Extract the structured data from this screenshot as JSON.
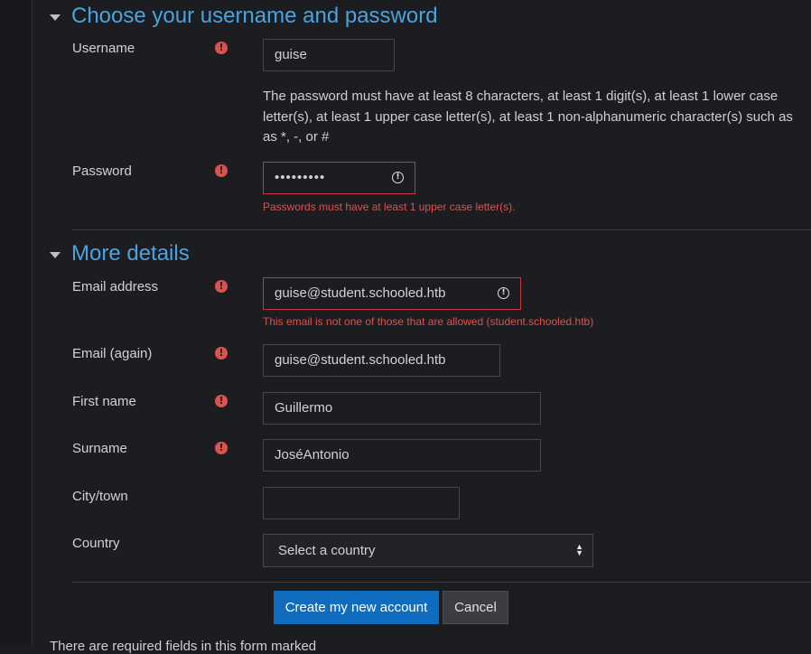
{
  "section_account": {
    "title": "Choose your username and password"
  },
  "username": {
    "label": "Username",
    "value": "guise"
  },
  "password_policy": "The password must have at least 8 characters, at least 1 digit(s), at least 1 lower case letter(s), at least 1 upper case letter(s), at least 1 non-alphanumeric character(s) such as as *, -, or #",
  "password": {
    "label": "Password",
    "value": "•••••••••",
    "error": "Passwords must have at least 1 upper case letter(s)."
  },
  "section_details": {
    "title": "More details"
  },
  "email": {
    "label": "Email address",
    "value": "guise@student.schooled.htb",
    "error": "This email is not one of those that are allowed (student.schooled.htb)"
  },
  "email_again": {
    "label": "Email (again)",
    "value": "guise@student.schooled.htb"
  },
  "firstname": {
    "label": "First name",
    "value": "Guillermo"
  },
  "surname": {
    "label": "Surname",
    "value": "JoséAntonio"
  },
  "city": {
    "label": "City/town",
    "value": ""
  },
  "country": {
    "label": "Country",
    "selected": "Select a country"
  },
  "buttons": {
    "create": "Create my new account",
    "cancel": "Cancel"
  },
  "footer_note": "There are required fields in this form marked"
}
